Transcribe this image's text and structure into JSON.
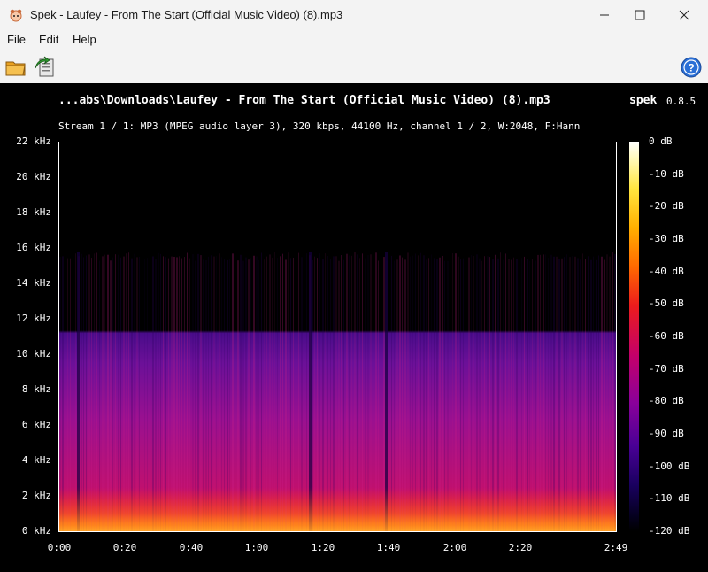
{
  "window": {
    "title": "Spek - Laufey - From The Start (Official Music Video) (8).mp3"
  },
  "menu": {
    "items": [
      "File",
      "Edit",
      "Help"
    ]
  },
  "toolbar": {
    "open_icon": "folder-open-icon",
    "save_icon": "save-export-icon",
    "help_icon": "help-icon"
  },
  "spectrogram": {
    "file_title": "...abs\\Downloads\\Laufey - From The Start (Official Music Video) (8).mp3",
    "app_name": "spek",
    "app_version": "0.8.5",
    "stream_info": "Stream 1 / 1: MP3 (MPEG audio layer 3), 320 kbps, 44100 Hz, channel 1 / 2, W:2048, F:Hann",
    "freq_labels": [
      "22 kHz",
      "20 kHz",
      "18 kHz",
      "16 kHz",
      "14 kHz",
      "12 kHz",
      "10 kHz",
      "8 kHz",
      "6 kHz",
      "4 kHz",
      "2 kHz",
      "0 kHz"
    ],
    "time_labels": [
      "0:00",
      "0:20",
      "0:40",
      "1:00",
      "1:20",
      "1:40",
      "2:00",
      "2:20",
      "2:49"
    ],
    "time_values_sec": [
      0,
      20,
      40,
      60,
      80,
      100,
      120,
      140,
      169
    ],
    "db_labels": [
      "0 dB",
      "-10 dB",
      "-20 dB",
      "-30 dB",
      "-40 dB",
      "-50 dB",
      "-60 dB",
      "-70 dB",
      "-80 dB",
      "-90 dB",
      "-100 dB",
      "-110 dB",
      "-120 dB"
    ],
    "duration_sec": 169,
    "max_freq_khz": 22,
    "cutoff_freq_khz": 16,
    "colors": {
      "background": "#000000",
      "low": "#3a0a8a",
      "mid": "#b0108a",
      "high": "#ff4010",
      "peak": "#ffe060"
    }
  }
}
